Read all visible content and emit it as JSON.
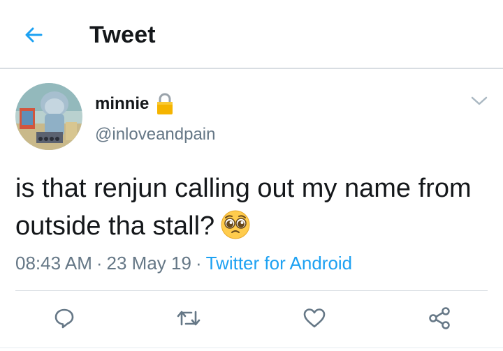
{
  "header": {
    "title": "Tweet",
    "back_icon": "arrow-left-icon"
  },
  "tweet": {
    "display_name": "minnie",
    "handle": "@inloveandpain",
    "protected_icon": "lock-icon",
    "text": "is that renjun calling out my name from outside tha stall?",
    "emoji": "pleading-face",
    "time": "08:43 AM",
    "date": "23 May 19",
    "separator": "·",
    "source": "Twitter for Android",
    "menu_icon": "chevron-down-icon"
  },
  "actions": [
    {
      "name": "reply",
      "icon": "reply-icon"
    },
    {
      "name": "retweet",
      "icon": "retweet-icon"
    },
    {
      "name": "like",
      "icon": "heart-icon"
    },
    {
      "name": "share",
      "icon": "share-icon"
    }
  ],
  "colors": {
    "accent": "#1da1f2",
    "secondary_text": "#657786",
    "divider": "#d8dde2",
    "lock": "#f5b400"
  }
}
